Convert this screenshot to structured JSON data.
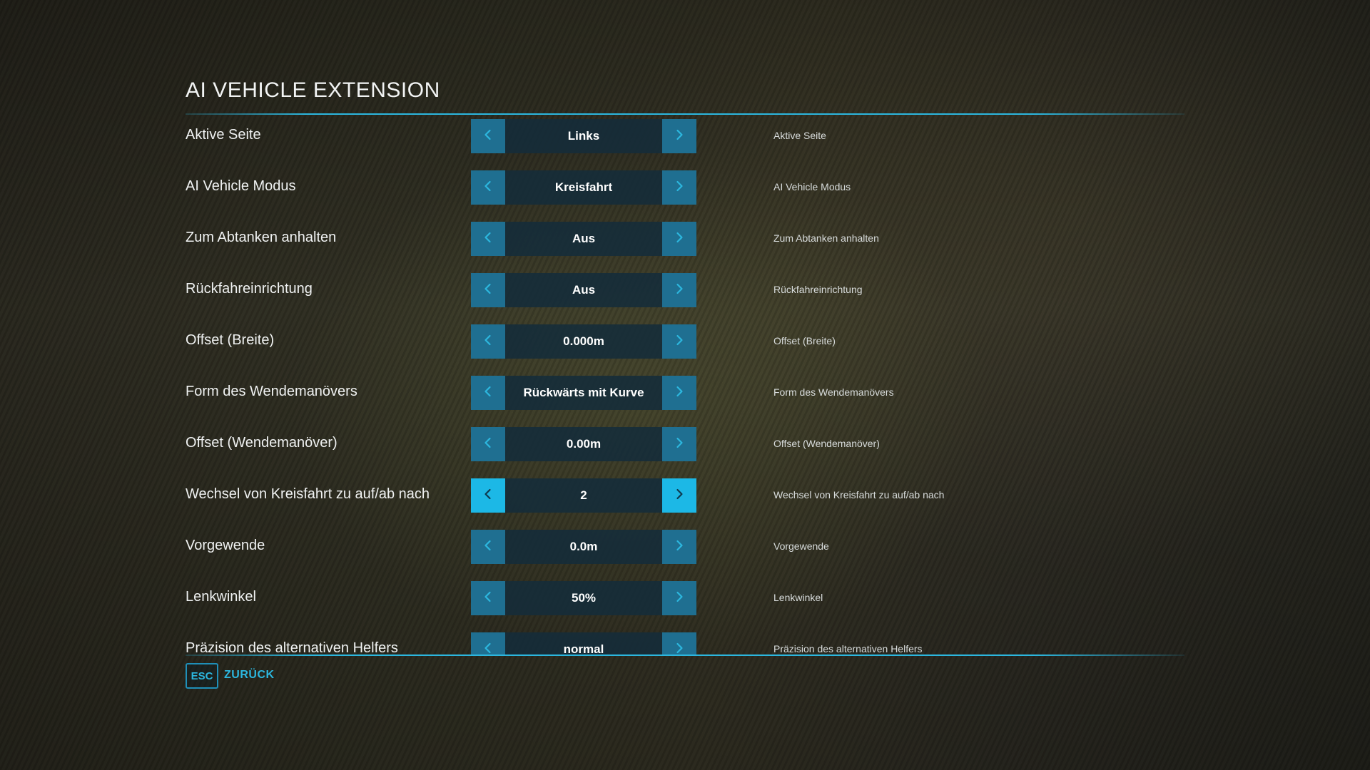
{
  "page": {
    "title": "AI VEHICLE EXTENSION",
    "accent_color": "#2cb7df"
  },
  "settings": [
    {
      "label": "Aktive Seite",
      "value": "Links",
      "description": "Aktive Seite",
      "active": false
    },
    {
      "label": "AI Vehicle Modus",
      "value": "Kreisfahrt",
      "description": "AI Vehicle Modus",
      "active": false
    },
    {
      "label": "Zum Abtanken anhalten",
      "value": "Aus",
      "description": "Zum Abtanken anhalten",
      "active": false
    },
    {
      "label": "Rückfahreinrichtung",
      "value": "Aus",
      "description": "Rückfahreinrichtung",
      "active": false
    },
    {
      "label": "Offset (Breite)",
      "value": "0.000m",
      "description": "Offset (Breite)",
      "active": false
    },
    {
      "label": "Form des Wendemanövers",
      "value": "Rückwärts mit Kurve",
      "description": "Form des Wendemanövers",
      "active": false
    },
    {
      "label": "Offset (Wendemanöver)",
      "value": "0.00m",
      "description": "Offset (Wendemanöver)",
      "active": false
    },
    {
      "label": "Wechsel von Kreisfahrt zu auf/ab nach",
      "value": "2",
      "description": "Wechsel von Kreisfahrt zu auf/ab nach",
      "active": true
    },
    {
      "label": "Vorgewende",
      "value": "0.0m",
      "description": "Vorgewende",
      "active": false
    },
    {
      "label": "Lenkwinkel",
      "value": "50%",
      "description": "Lenkwinkel",
      "active": false
    },
    {
      "label": "Präzision des alternativen Helfers",
      "value": "normal",
      "description": "Präzision des alternativen Helfers",
      "active": false
    }
  ],
  "icons": {
    "left_arrow": "chevron-left-icon",
    "right_arrow": "chevron-right-icon"
  },
  "footer": {
    "key_label": "ESC",
    "back_label": "ZURÜCK"
  }
}
